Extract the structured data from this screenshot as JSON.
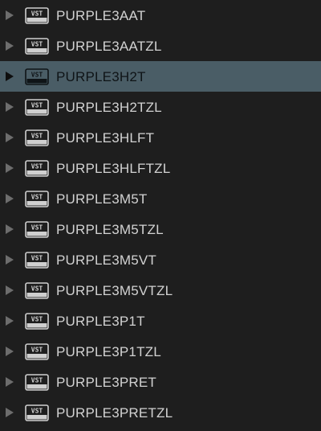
{
  "browser": {
    "plugin_icon": "vst-plugin-icon",
    "expand_icon": "expand-arrow-icon",
    "colors": {
      "background": "#1e1e1e",
      "selected_row": "#4a5d66",
      "text": "#d2d2d2",
      "selected_text": "#0f1417",
      "arrow": "#6d6d6d"
    },
    "items": [
      {
        "label": "PURPLE3AAT",
        "selected": false
      },
      {
        "label": "PURPLE3AATZL",
        "selected": false
      },
      {
        "label": "PURPLE3H2T",
        "selected": true
      },
      {
        "label": "PURPLE3H2TZL",
        "selected": false
      },
      {
        "label": "PURPLE3HLFT",
        "selected": false
      },
      {
        "label": "PURPLE3HLFTZL",
        "selected": false
      },
      {
        "label": "PURPLE3M5T",
        "selected": false
      },
      {
        "label": "PURPLE3M5TZL",
        "selected": false
      },
      {
        "label": "PURPLE3M5VT",
        "selected": false
      },
      {
        "label": "PURPLE3M5VTZL",
        "selected": false
      },
      {
        "label": "PURPLE3P1T",
        "selected": false
      },
      {
        "label": "PURPLE3P1TZL",
        "selected": false
      },
      {
        "label": "PURPLE3PRET",
        "selected": false
      },
      {
        "label": "PURPLE3PRETZL",
        "selected": false
      }
    ]
  }
}
